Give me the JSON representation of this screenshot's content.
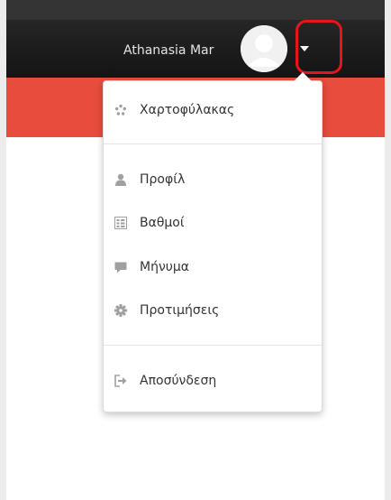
{
  "navbar": {
    "user_name": "Athanasia Mar"
  },
  "menu": {
    "items": [
      {
        "label": "Χαρτοφύλακας",
        "icon": "portfolio-icon"
      },
      {
        "label": "Προφίλ",
        "icon": "user-icon"
      },
      {
        "label": "Βαθμοί",
        "icon": "grades-icon"
      },
      {
        "label": "Μήνυμα",
        "icon": "message-icon"
      },
      {
        "label": "Προτιμήσεις",
        "icon": "gear-icon"
      },
      {
        "label": "Αποσύνδεση",
        "icon": "logout-icon"
      }
    ]
  },
  "colors": {
    "navbar": "#1c1c1c",
    "accent_bar": "#e74c3c",
    "highlight": "#e8141c",
    "icon": "#999999",
    "text": "#333333"
  }
}
